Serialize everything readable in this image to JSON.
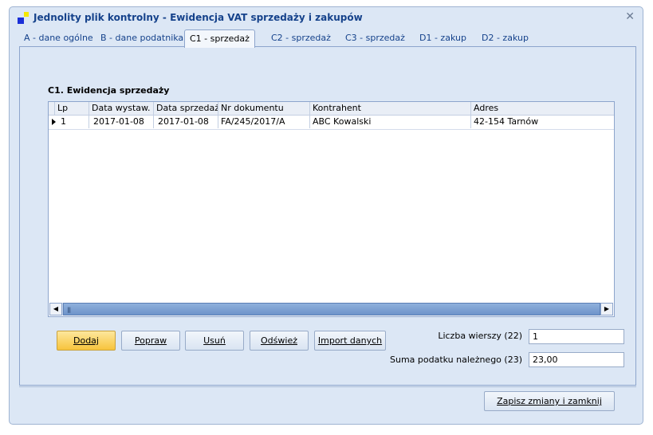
{
  "window": {
    "title": "Jednolity plik kontrolny - Ewidencja VAT sprzedaży i zakupów",
    "close_symbol": "✕"
  },
  "tabs": [
    {
      "label": "A - dane ogólne",
      "active": false
    },
    {
      "label": "B  - dane podatnika",
      "active": false
    },
    {
      "label": "C1  - sprzedaż",
      "active": true
    },
    {
      "label": "C2  - sprzedaż",
      "active": false
    },
    {
      "label": "C3  - sprzedaż",
      "active": false
    },
    {
      "label": "D1  - zakup",
      "active": false
    },
    {
      "label": "D2  - zakup",
      "active": false
    }
  ],
  "section": {
    "title": "C1. Ewidencja sprzedaży"
  },
  "table": {
    "columns": [
      "Lp",
      "Data wystaw.",
      "Data sprzedaży",
      "Nr dokumentu",
      "Kontrahent",
      "Adres"
    ],
    "rows": [
      {
        "lp": "1",
        "data_wystaw": "2017-01-08",
        "data_sprzedazy": "2017-01-08",
        "nr_dokumentu": "FA/245/2017/A",
        "kontrahent": "ABC Kowalski",
        "adres": "42-154 Tarnów"
      }
    ]
  },
  "scrollbar": {
    "left_arrow": "◀",
    "right_arrow": "▶",
    "grip": "|||"
  },
  "buttons": {
    "add": "Dodaj",
    "edit": "Popraw",
    "delete": "Usuń",
    "refresh": "Odśwież",
    "import": "Import danych",
    "save_close": "Zapisz zmiany i zamknij"
  },
  "summary": {
    "row_count_label": "Liczba wierszy (22)",
    "row_count_value": "1",
    "tax_sum_label": "Suma podatku należnego (23)",
    "tax_sum_value": "23,00"
  },
  "colors": {
    "window_bg": "#dce7f5",
    "title_text": "#15428b",
    "primary_button": "#f7c43d"
  }
}
